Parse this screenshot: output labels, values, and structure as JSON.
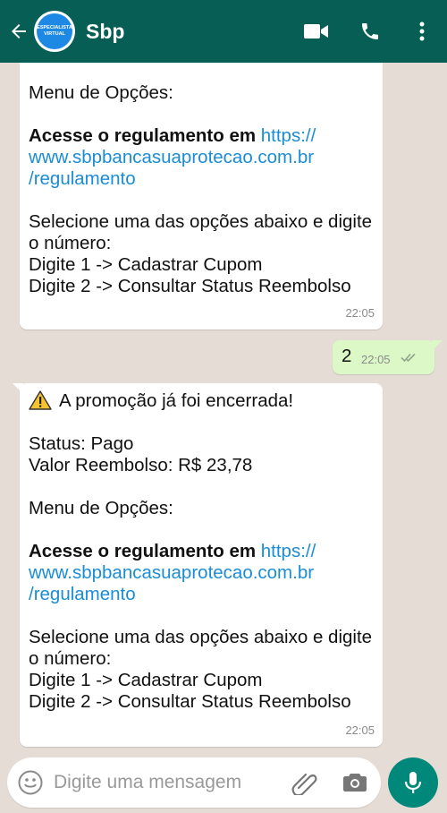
{
  "header": {
    "contact_name": "Sbp",
    "avatar_text_line1": "ESPECIALISTA",
    "avatar_text_line2": "VIRTUAL",
    "colors": {
      "bar": "#075e54",
      "avatar": "#1e88e5"
    },
    "icons": [
      "back-arrow-icon",
      "video-call-icon",
      "phone-icon",
      "more-vert-icon"
    ]
  },
  "messages": [
    {
      "direction": "incoming",
      "lines": [
        {
          "text": "Menu de Opções:"
        },
        {
          "text": ""
        },
        {
          "bold": "Acesse o regulamento em ",
          "link": "https://"
        },
        {
          "link": "www.sbpbancasuaprotecao.com.br"
        },
        {
          "link": "/regulamento"
        },
        {
          "text": ""
        },
        {
          "text": "Selecione uma das opções abaixo e digite"
        },
        {
          "text": "o número:"
        },
        {
          "text": "Digite 1 -> Cadastrar Cupom"
        },
        {
          "text": "Digite 2 -> Consultar Status Reembolso"
        }
      ],
      "time": "22:05"
    },
    {
      "direction": "outgoing",
      "text": "2",
      "time": "22:05",
      "status": "read"
    },
    {
      "direction": "incoming",
      "lines": [
        {
          "icon": "warning-icon",
          "text": "A promoção já foi encerrada!"
        },
        {
          "text": ""
        },
        {
          "text": "Status: Pago"
        },
        {
          "text": "Valor Reembolso: R$ 23,78"
        },
        {
          "text": ""
        },
        {
          "text": "Menu de Opções:"
        },
        {
          "text": ""
        },
        {
          "bold": "Acesse o regulamento em ",
          "link": "https://"
        },
        {
          "link": "www.sbpbancasuaprotecao.com.br"
        },
        {
          "link": "/regulamento"
        },
        {
          "text": ""
        },
        {
          "text": "Selecione uma das opções abaixo e digite"
        },
        {
          "text": "o número:"
        },
        {
          "text": "Digite 1 -> Cadastrar Cupom"
        },
        {
          "text": "Digite 2 -> Consultar Status Reembolso"
        }
      ],
      "time": "22:05"
    }
  ],
  "composer": {
    "placeholder": "Digite uma mensagem",
    "icons": [
      "emoji-icon",
      "attach-icon",
      "camera-icon",
      "mic-icon"
    ],
    "mic_color": "#00897b"
  },
  "colors": {
    "chat_bg": "#e5ddd5",
    "outgoing_bubble": "#dcf8c6",
    "link": "#1a8dd6"
  }
}
